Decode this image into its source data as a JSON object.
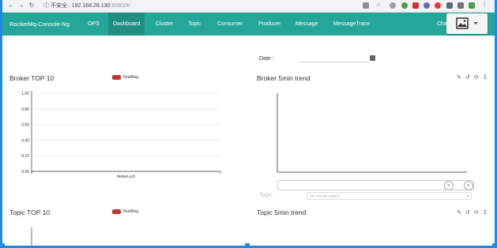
{
  "browser": {
    "security": "不安全",
    "url_host": "192.168.28.130",
    "url_rest": ":8080/#/"
  },
  "navbar": {
    "brand": "RocketMq-Console-Ng",
    "items": [
      "OPS",
      "Dashboard",
      "Cluster",
      "Topic",
      "Consumer",
      "Producer",
      "Message",
      "MessageTrace"
    ],
    "active": "Dashboard",
    "right_label": "Cha"
  },
  "date": {
    "label": "Date :"
  },
  "broker_top": {
    "title": "Broker TOP 10",
    "legend": "TotalMsg",
    "y_ticks": [
      "1.00",
      "0.80",
      "0.60",
      "0.40",
      "0.20",
      "0.00"
    ],
    "x_label": "broker-a:0"
  },
  "broker_trend": {
    "title": "Broker 5min trend"
  },
  "topic_filter": {
    "label": "Topic :",
    "placeholder": "No results match"
  },
  "topic_top": {
    "title": "Topic TOP 10",
    "legend": "TotalMsg"
  },
  "topic_trend": {
    "title": "Topic 5min trend"
  },
  "colors": {
    "accent": "#26a69a",
    "accent_active": "#1f8f84",
    "legend": "#c23531",
    "frame": "#1e88e5"
  },
  "chart_data": [
    {
      "type": "bar",
      "title": "Broker TOP 10",
      "categories": [
        "broker-a:0"
      ],
      "series": [
        {
          "name": "TotalMsg",
          "values": [
            0
          ]
        }
      ],
      "ylim": [
        0,
        1
      ],
      "grid": true,
      "legend": "top"
    }
  ]
}
